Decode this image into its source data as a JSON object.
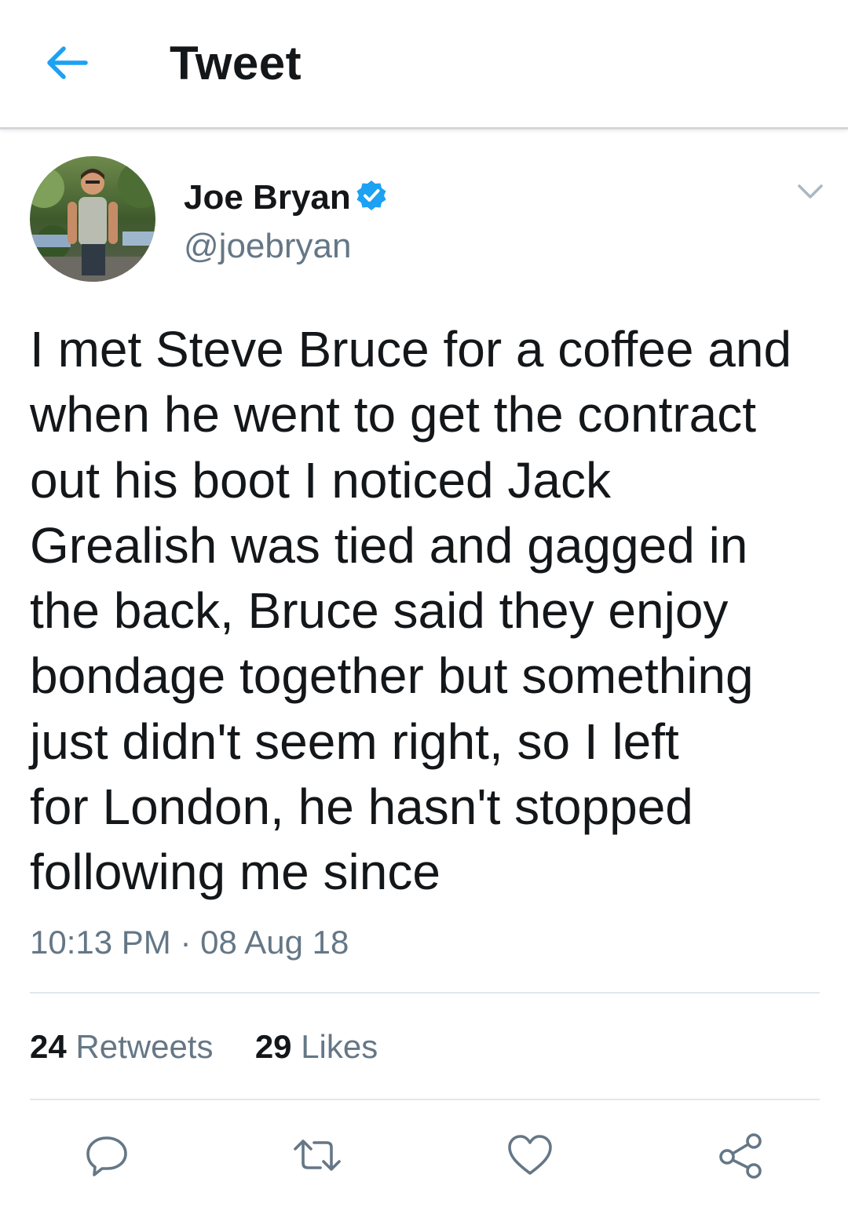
{
  "header": {
    "title": "Tweet",
    "back_icon": "arrow-left-icon",
    "accent_color": "#1da1f2"
  },
  "tweet": {
    "author": {
      "display_name": "Joe Bryan",
      "handle": "@joebryan",
      "verified": true
    },
    "text_lines": [
      "I met Steve Bruce for a coffee and",
      "when he went to get the contract",
      "out his boot I noticed Jack",
      "Grealish was tied and gagged in",
      "the back, Bruce said they enjoy",
      "bondage together but something",
      "just didn't seem right, so I left",
      "for London, he hasn't stopped",
      "following me since"
    ],
    "time": "10:13 PM",
    "separator": "·",
    "date": "08 Aug 18",
    "stats": {
      "retweets_count": "24",
      "retweets_label": "Retweets",
      "likes_count": "29",
      "likes_label": "Likes"
    },
    "actions": [
      "reply-icon",
      "retweet-icon",
      "like-icon",
      "share-icon"
    ]
  },
  "colors": {
    "text_primary": "#14171a",
    "text_secondary": "#657786",
    "divider": "#e1e8ed",
    "verified_badge": "#1da1f2"
  }
}
